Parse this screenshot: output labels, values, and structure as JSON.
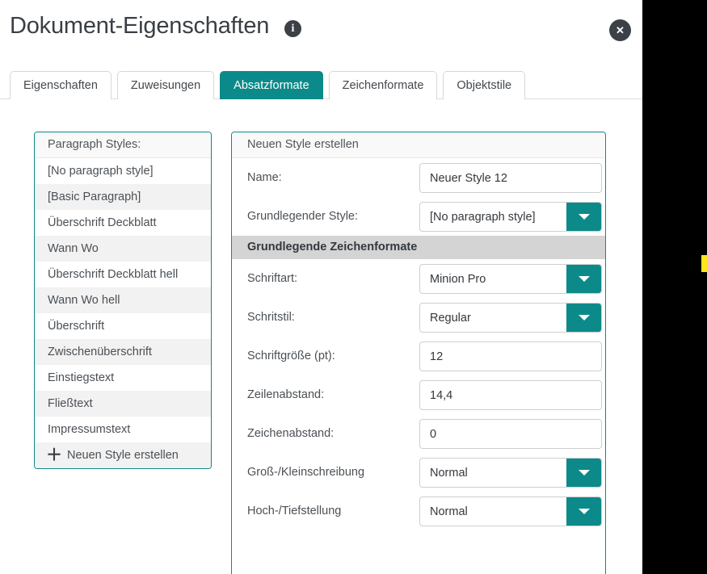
{
  "window": {
    "title": "Dokument-Eigenschaften",
    "info_icon": "info-icon",
    "info_glyph": "i",
    "close_icon": "close-icon",
    "close_glyph": "✕"
  },
  "tabs": [
    {
      "label": "Eigenschaften",
      "active": false
    },
    {
      "label": "Zuweisungen",
      "active": false
    },
    {
      "label": "Absatzformate",
      "active": true
    },
    {
      "label": "Zeichenformate",
      "active": false
    },
    {
      "label": "Objektstile",
      "active": false
    }
  ],
  "style_list": {
    "header": "Paragraph Styles:",
    "items": [
      "[No paragraph style]",
      "[Basic Paragraph]",
      "Überschrift Deckblatt",
      "Wann Wo",
      "Überschrift Deckblatt hell",
      "Wann Wo hell",
      "Überschrift",
      "Zwischenüberschrift",
      "Einstiegstext",
      "Fließtext",
      "Impressumstext"
    ],
    "create_label": "Neuen Style erstellen",
    "create_icon": "plus-icon",
    "create_glyph": "＋"
  },
  "style_form": {
    "header": "Neuen Style erstellen",
    "section_title": "Grundlegende Zeichenformate",
    "fields": [
      {
        "label": "Name:",
        "value": "Neuer Style 12",
        "type": "text"
      },
      {
        "label": "Grundlegender Style:",
        "value": "[No paragraph style]",
        "type": "select"
      }
    ],
    "character_fields": [
      {
        "label": "Schriftart:",
        "value": "Minion Pro",
        "type": "select"
      },
      {
        "label": "Schritstil:",
        "value": "Regular",
        "type": "select"
      },
      {
        "label": "Schriftgröße (pt):",
        "value": "12",
        "type": "text"
      },
      {
        "label": "Zeilenabstand:",
        "value": "14,4",
        "type": "text"
      },
      {
        "label": "Zeichenabstand:",
        "value": "0",
        "type": "text"
      },
      {
        "label": "Groß-/Kleinschreibung",
        "value": "Normal",
        "type": "select"
      },
      {
        "label": "Hoch-/Tiefstellung",
        "value": "Normal",
        "type": "select"
      }
    ]
  },
  "colors": {
    "accent_teal": "#0c8a8a",
    "dark_chrome": "#3c4047",
    "section_gray": "#d4d4d4",
    "row_alt_gray": "#f2f2f2",
    "edge_marker_yellow": "#ffe61a"
  }
}
